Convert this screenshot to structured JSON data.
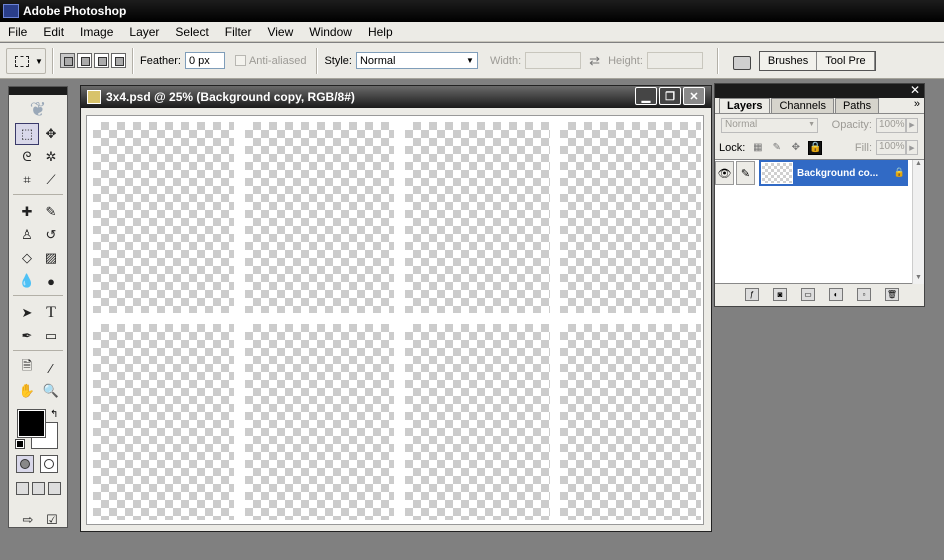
{
  "app": {
    "title": "Adobe Photoshop"
  },
  "menu": [
    "File",
    "Edit",
    "Image",
    "Layer",
    "Select",
    "Filter",
    "View",
    "Window",
    "Help"
  ],
  "options": {
    "feather_label": "Feather:",
    "feather_value": "0 px",
    "anti_aliased_label": "Anti-aliased",
    "style_label": "Style:",
    "style_value": "Normal",
    "width_label": "Width:",
    "height_label": "Height:",
    "well_tabs": [
      "Brushes",
      "Tool Pre"
    ]
  },
  "document": {
    "title": "3x4.psd @ 25% (Background copy, RGB/8#)"
  },
  "layers_palette": {
    "tabs": [
      "Layers",
      "Channels",
      "Paths"
    ],
    "blend_mode": "Normal",
    "opacity_label": "Opacity:",
    "opacity_value": "100%",
    "lock_label": "Lock:",
    "fill_label": "Fill:",
    "fill_value": "100%",
    "layers": [
      {
        "name": "Background co..."
      }
    ]
  },
  "colors": {
    "foreground": "#000000",
    "background": "#ffffff",
    "selection": "#316ac5"
  },
  "icons": {
    "toolbox": [
      "marquee",
      "move",
      "lasso",
      "magic-wand",
      "crop",
      "slice",
      "healing",
      "brush",
      "clone-stamp",
      "history-brush",
      "eraser",
      "gradient",
      "blur",
      "dodge",
      "path-select",
      "type",
      "pen",
      "shape",
      "notes",
      "eyedropper",
      "hand",
      "zoom"
    ]
  }
}
